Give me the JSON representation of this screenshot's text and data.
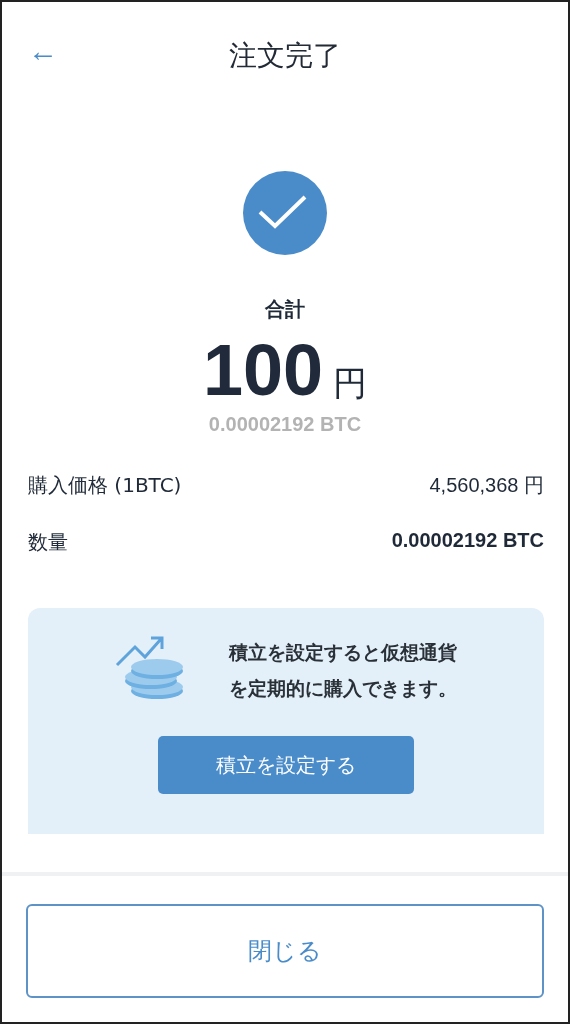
{
  "header": {
    "back": "←",
    "title": "注文完了"
  },
  "status": {
    "success": true
  },
  "total": {
    "label": "合計",
    "amount": "100",
    "unit": "円",
    "crypto": "0.00002192 BTC"
  },
  "details": [
    {
      "label": "購入価格 (1BTC)",
      "value": "4,560,368 円",
      "bold": false
    },
    {
      "label": "数量",
      "value": "0.00002192 BTC",
      "bold": true
    }
  ],
  "promo": {
    "lines": [
      "積立を設定すると仮想通貨",
      "を定期的に購入できます。"
    ],
    "button": "積立を設定する"
  },
  "footer": {
    "button": "閉じる"
  }
}
